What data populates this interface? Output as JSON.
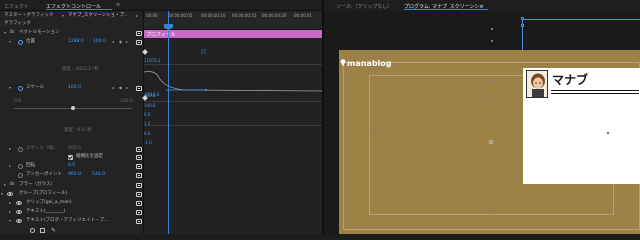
{
  "left_panel": {
    "tabs": [
      "エフェクト",
      "エフェクトコントロール",
      "≡"
    ],
    "source_label": "マスター・グラフィック",
    "sequence_label": "マナブ_スクリーンショ・プ..",
    "section": "グラフィック",
    "vector_motion": "ベクトルモーション",
    "position": {
      "label": "位置",
      "x": "1288.0",
      "y": "100.0"
    },
    "velocity1": "速度 : 3453.2 /秒",
    "scale": {
      "label": "スケール",
      "value": "100.0"
    },
    "slider_min": "0.0",
    "slider_max": "200.0",
    "velocity2": "速度 : 0.0 /秒",
    "scale_width": {
      "label": "スケール（幅）",
      "value": "100.0"
    },
    "uniform_scale": "縦横比を固定",
    "rotation": {
      "label": "回転",
      "value": "0.0"
    },
    "anchor": {
      "label": "アンカーポイント",
      "x": "960.0",
      "y": "540.0"
    },
    "blur": "ブラー（ガウス）",
    "group": "グループ(プロフィール)",
    "clip": "クリップ(gai_a_man)",
    "text1": "テキスト(________)",
    "text2": "テキスト(ブログ・アフィリエイト・プ..."
  },
  "timeline": {
    "timecodes": [
      "00:00",
      "00:00:00:05",
      "00:00:00:10",
      "00:00:00:15",
      "00:00:00:20",
      "00:00:01"
    ],
    "clip_label": "プロフィール",
    "graph_top": "11874.2",
    "graph_mid": "0.0",
    "graph_bot": "-1011.6",
    "scale_graph": [
      "300.0",
      "100.0",
      "0.0",
      "1.0",
      "0.0",
      "-1.0"
    ]
  },
  "right_panel": {
    "tabs": [
      "ソース:（クリップなし）",
      "プログラム: マナブ_スクリーンシ≡"
    ],
    "blog_name": "manablog",
    "card_name": "マナブ"
  },
  "colors": {
    "accent": "#3b82d6",
    "clip": "#c86bc8",
    "canvas": "#9c8147"
  }
}
